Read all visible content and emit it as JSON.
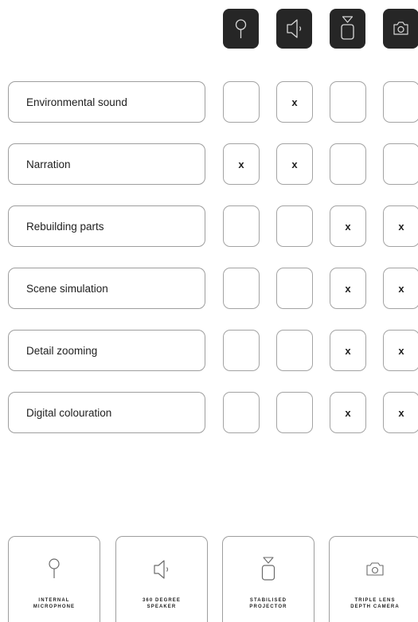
{
  "header_icons": [
    {
      "name": "microphone-icon"
    },
    {
      "name": "speaker-icon"
    },
    {
      "name": "projector-icon"
    },
    {
      "name": "camera-icon"
    }
  ],
  "rows": [
    {
      "label": "Environmental sound",
      "cells": [
        "",
        "x",
        "",
        ""
      ]
    },
    {
      "label": "Narration",
      "cells": [
        "x",
        "x",
        "",
        ""
      ]
    },
    {
      "label": "Rebuilding parts",
      "cells": [
        "",
        "",
        "x",
        "x"
      ]
    },
    {
      "label": "Scene simulation",
      "cells": [
        "",
        "",
        "x",
        "x"
      ]
    },
    {
      "label": "Detail zooming",
      "cells": [
        "",
        "",
        "x",
        "x"
      ]
    },
    {
      "label": "Digital colouration",
      "cells": [
        "",
        "",
        "x",
        "x"
      ]
    }
  ],
  "devices": [
    {
      "icon": "microphone-icon",
      "line1": "INTERNAL",
      "line2": "MICROPHONE"
    },
    {
      "icon": "speaker-icon",
      "line1": "360 DEGREE",
      "line2": "SPEAKER"
    },
    {
      "icon": "projector-icon",
      "line1": "STABILISED",
      "line2": "PROJECTOR"
    },
    {
      "icon": "camera-icon",
      "line1": "TRIPLE LENS",
      "line2": "DEPTH CAMERA"
    }
  ]
}
